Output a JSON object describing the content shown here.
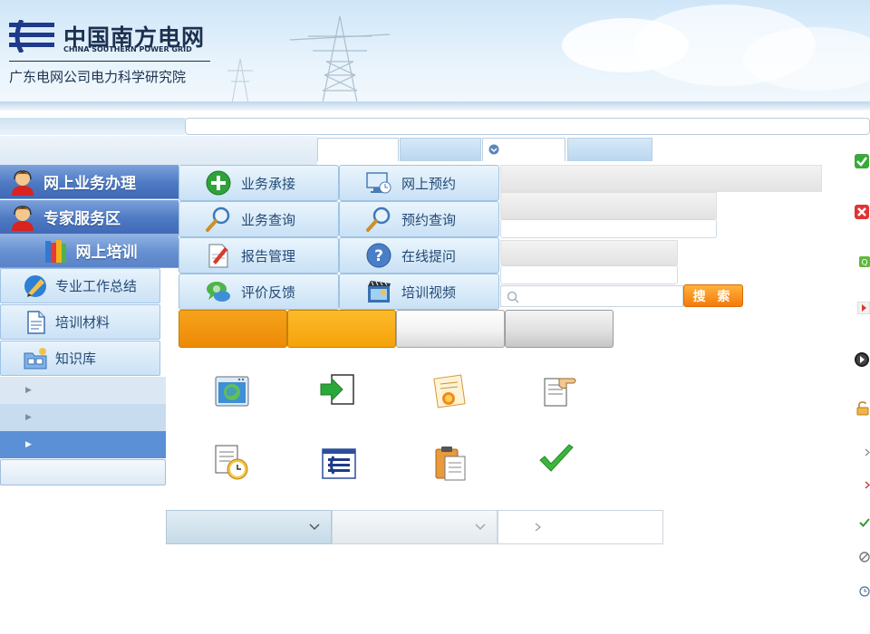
{
  "header": {
    "brand_cn": "中国南方电网",
    "brand_en": "CHINA SOUTHERN POWER GRID",
    "subtitle": "广东电网公司电力科学研究院"
  },
  "nav": {
    "main": [
      {
        "label": "网上业务办理",
        "icon": "customer-service-icon"
      },
      {
        "label": "专家服务区",
        "icon": "customer-service-icon"
      },
      {
        "label": "网上培训",
        "icon": "books-icon"
      }
    ],
    "sub": [
      {
        "label": "专业工作总结",
        "icon": "pen-note-icon"
      },
      {
        "label": "培训材料",
        "icon": "document-icon"
      },
      {
        "label": "知识库",
        "icon": "folder-network-icon"
      }
    ]
  },
  "services": [
    {
      "label": "业务承接",
      "icon": "add-icon"
    },
    {
      "label": "网上预约",
      "icon": "monitor-clock-icon"
    },
    {
      "label": "业务查询",
      "icon": "magnifier-icon"
    },
    {
      "label": "预约查询",
      "icon": "magnifier-icon"
    },
    {
      "label": "报告管理",
      "icon": "report-edit-icon"
    },
    {
      "label": "在线提问",
      "icon": "help-icon"
    },
    {
      "label": "评价反馈",
      "icon": "chat-icon"
    },
    {
      "label": "培训视频",
      "icon": "video-icon"
    }
  ],
  "search": {
    "placeholder": "",
    "button_label": "搜 索"
  },
  "colors": {
    "accent": "#4e79c3",
    "orange": "#f5a20a",
    "search": "#f47a0c"
  },
  "icons": {
    "grid": [
      "globe-window-icon",
      "enter-arrow-icon",
      "certificate-icon",
      "pointer-document-icon",
      "document-clock-icon",
      "logo-window-icon",
      "clipboard-icon",
      "checkmark-icon"
    ],
    "right": [
      "check-icon",
      "close-icon",
      "q-badge-icon",
      "play-icon",
      "media-next-icon",
      "unlock-icon",
      "chevron-right-icon",
      "chevron-right-red-icon",
      "small-check-icon",
      "disabled-icon",
      "clock-icon"
    ]
  }
}
